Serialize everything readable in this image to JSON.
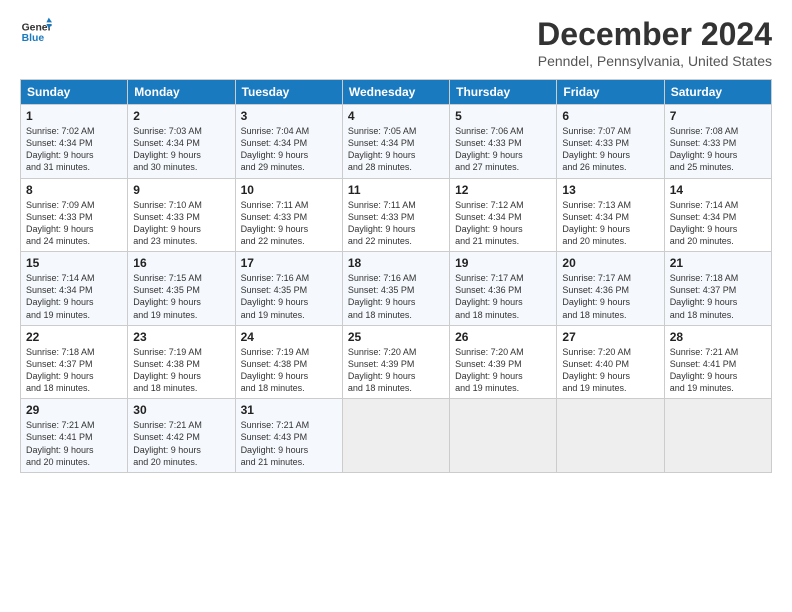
{
  "header": {
    "logo_line1": "General",
    "logo_line2": "Blue",
    "month": "December 2024",
    "location": "Penndel, Pennsylvania, United States"
  },
  "days_of_week": [
    "Sunday",
    "Monday",
    "Tuesday",
    "Wednesday",
    "Thursday",
    "Friday",
    "Saturday"
  ],
  "weeks": [
    [
      {
        "day": 1,
        "info": "Sunrise: 7:02 AM\nSunset: 4:34 PM\nDaylight: 9 hours\nand 31 minutes."
      },
      {
        "day": 2,
        "info": "Sunrise: 7:03 AM\nSunset: 4:34 PM\nDaylight: 9 hours\nand 30 minutes."
      },
      {
        "day": 3,
        "info": "Sunrise: 7:04 AM\nSunset: 4:34 PM\nDaylight: 9 hours\nand 29 minutes."
      },
      {
        "day": 4,
        "info": "Sunrise: 7:05 AM\nSunset: 4:34 PM\nDaylight: 9 hours\nand 28 minutes."
      },
      {
        "day": 5,
        "info": "Sunrise: 7:06 AM\nSunset: 4:33 PM\nDaylight: 9 hours\nand 27 minutes."
      },
      {
        "day": 6,
        "info": "Sunrise: 7:07 AM\nSunset: 4:33 PM\nDaylight: 9 hours\nand 26 minutes."
      },
      {
        "day": 7,
        "info": "Sunrise: 7:08 AM\nSunset: 4:33 PM\nDaylight: 9 hours\nand 25 minutes."
      }
    ],
    [
      {
        "day": 8,
        "info": "Sunrise: 7:09 AM\nSunset: 4:33 PM\nDaylight: 9 hours\nand 24 minutes."
      },
      {
        "day": 9,
        "info": "Sunrise: 7:10 AM\nSunset: 4:33 PM\nDaylight: 9 hours\nand 23 minutes."
      },
      {
        "day": 10,
        "info": "Sunrise: 7:11 AM\nSunset: 4:33 PM\nDaylight: 9 hours\nand 22 minutes."
      },
      {
        "day": 11,
        "info": "Sunrise: 7:11 AM\nSunset: 4:33 PM\nDaylight: 9 hours\nand 22 minutes."
      },
      {
        "day": 12,
        "info": "Sunrise: 7:12 AM\nSunset: 4:34 PM\nDaylight: 9 hours\nand 21 minutes."
      },
      {
        "day": 13,
        "info": "Sunrise: 7:13 AM\nSunset: 4:34 PM\nDaylight: 9 hours\nand 20 minutes."
      },
      {
        "day": 14,
        "info": "Sunrise: 7:14 AM\nSunset: 4:34 PM\nDaylight: 9 hours\nand 20 minutes."
      }
    ],
    [
      {
        "day": 15,
        "info": "Sunrise: 7:14 AM\nSunset: 4:34 PM\nDaylight: 9 hours\nand 19 minutes."
      },
      {
        "day": 16,
        "info": "Sunrise: 7:15 AM\nSunset: 4:35 PM\nDaylight: 9 hours\nand 19 minutes."
      },
      {
        "day": 17,
        "info": "Sunrise: 7:16 AM\nSunset: 4:35 PM\nDaylight: 9 hours\nand 19 minutes."
      },
      {
        "day": 18,
        "info": "Sunrise: 7:16 AM\nSunset: 4:35 PM\nDaylight: 9 hours\nand 18 minutes."
      },
      {
        "day": 19,
        "info": "Sunrise: 7:17 AM\nSunset: 4:36 PM\nDaylight: 9 hours\nand 18 minutes."
      },
      {
        "day": 20,
        "info": "Sunrise: 7:17 AM\nSunset: 4:36 PM\nDaylight: 9 hours\nand 18 minutes."
      },
      {
        "day": 21,
        "info": "Sunrise: 7:18 AM\nSunset: 4:37 PM\nDaylight: 9 hours\nand 18 minutes."
      }
    ],
    [
      {
        "day": 22,
        "info": "Sunrise: 7:18 AM\nSunset: 4:37 PM\nDaylight: 9 hours\nand 18 minutes."
      },
      {
        "day": 23,
        "info": "Sunrise: 7:19 AM\nSunset: 4:38 PM\nDaylight: 9 hours\nand 18 minutes."
      },
      {
        "day": 24,
        "info": "Sunrise: 7:19 AM\nSunset: 4:38 PM\nDaylight: 9 hours\nand 18 minutes."
      },
      {
        "day": 25,
        "info": "Sunrise: 7:20 AM\nSunset: 4:39 PM\nDaylight: 9 hours\nand 18 minutes."
      },
      {
        "day": 26,
        "info": "Sunrise: 7:20 AM\nSunset: 4:39 PM\nDaylight: 9 hours\nand 19 minutes."
      },
      {
        "day": 27,
        "info": "Sunrise: 7:20 AM\nSunset: 4:40 PM\nDaylight: 9 hours\nand 19 minutes."
      },
      {
        "day": 28,
        "info": "Sunrise: 7:21 AM\nSunset: 4:41 PM\nDaylight: 9 hours\nand 19 minutes."
      }
    ],
    [
      {
        "day": 29,
        "info": "Sunrise: 7:21 AM\nSunset: 4:41 PM\nDaylight: 9 hours\nand 20 minutes."
      },
      {
        "day": 30,
        "info": "Sunrise: 7:21 AM\nSunset: 4:42 PM\nDaylight: 9 hours\nand 20 minutes."
      },
      {
        "day": 31,
        "info": "Sunrise: 7:21 AM\nSunset: 4:43 PM\nDaylight: 9 hours\nand 21 minutes."
      },
      null,
      null,
      null,
      null
    ]
  ]
}
